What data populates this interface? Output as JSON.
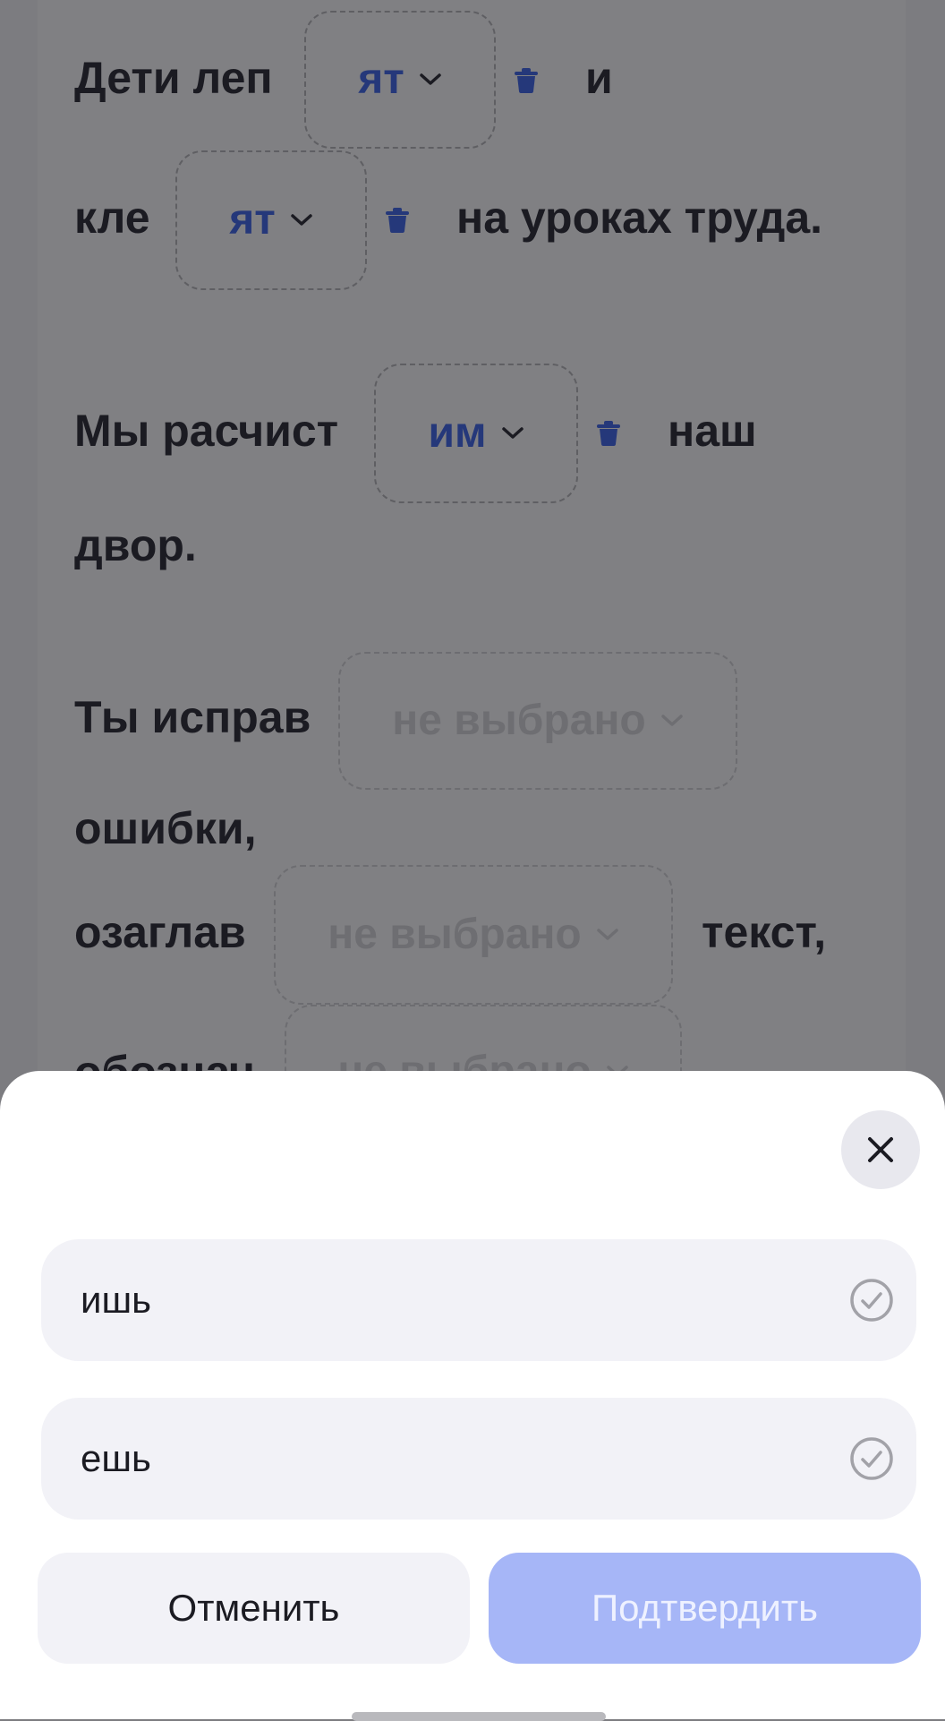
{
  "background": {
    "placeholder": "не выбрано",
    "sentence1": {
      "w1": "Дети леп",
      "slot1": "ят",
      "w2": "и",
      "w3": "кле",
      "slot2": "ят",
      "w4": "на уроках труда."
    },
    "sentence2": {
      "w1": "Мы расчист",
      "slot1": "им",
      "w2": "наш",
      "w3": "двор."
    },
    "sentence3": {
      "w1": "Ты исправ",
      "w2": "ошибки,",
      "w3": "озаглав",
      "w4": "текст,",
      "w5": "обознач"
    }
  },
  "sheet": {
    "options": [
      {
        "label": "ишь"
      },
      {
        "label": "ешь"
      }
    ],
    "cancel_label": "Отменить",
    "confirm_label": "Подтвердить"
  },
  "colors": {
    "accent": "#25387a",
    "confirm_disabled": "#a6b6f7",
    "option_bg": "#f2f2f7"
  },
  "icons": {
    "close": "close-icon",
    "delete": "trash-icon",
    "dropdown": "chevron-down-icon",
    "option_check": "check-circle-icon"
  }
}
